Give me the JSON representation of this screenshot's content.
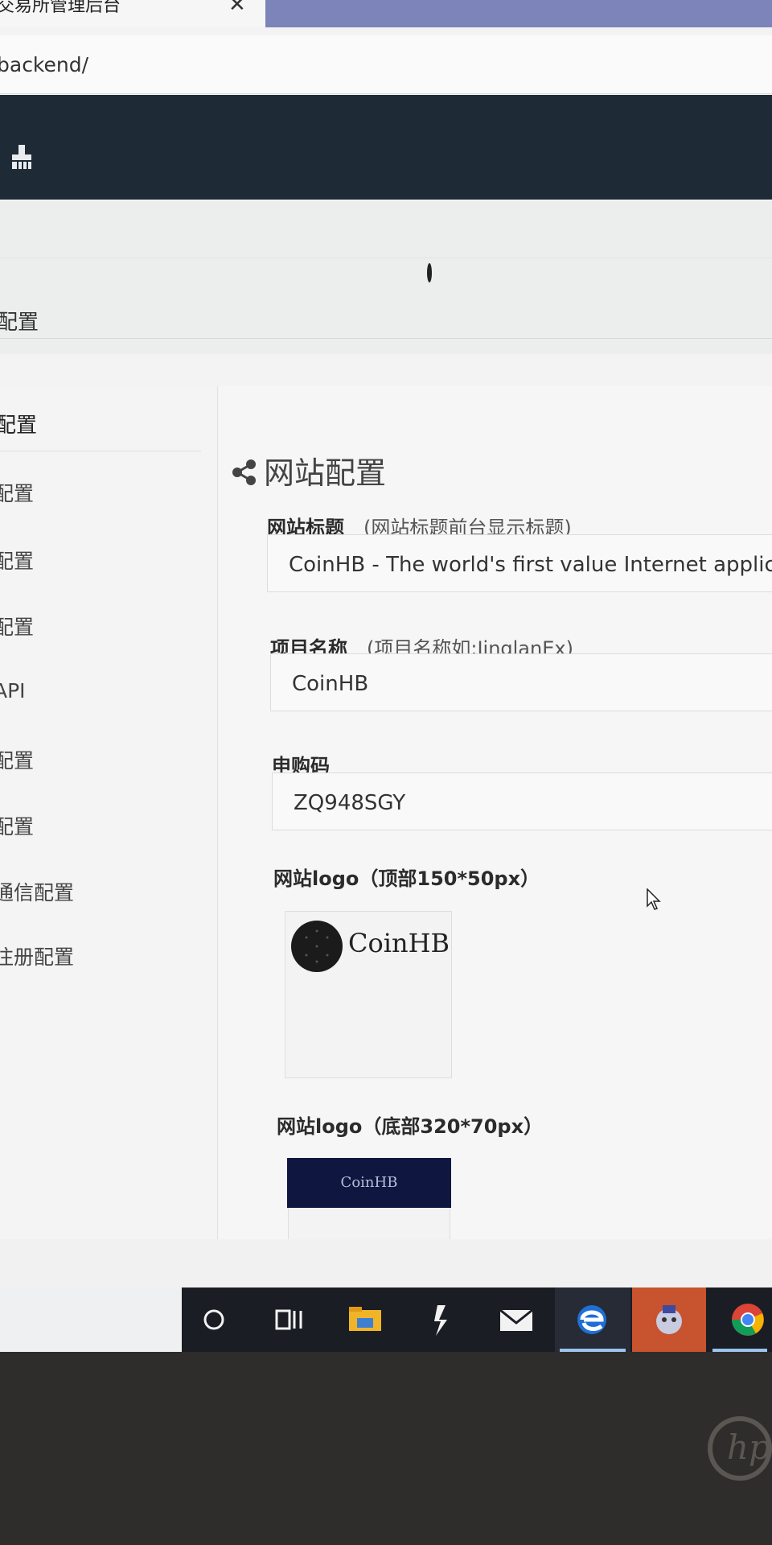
{
  "browser": {
    "tab_title": "交易所管理后台",
    "tab_close": "✕",
    "url": "backend/"
  },
  "breadcrumb": "配置",
  "sidebar": {
    "header": "配置",
    "items": [
      "配置",
      "配置",
      "配置",
      "API",
      "配置",
      "配置",
      "通信配置",
      "注册配置"
    ]
  },
  "main": {
    "section_title": "网站配置",
    "fields": [
      {
        "label": "网站标题",
        "hint": "(网站标题前台显示标题)",
        "value": "CoinHB - The world's first value Internet application"
      },
      {
        "label": "项目名称",
        "hint": "(项目名称如:JinglanEx)",
        "value": "CoinHB"
      },
      {
        "label": "申购码",
        "hint": "",
        "value": "ZQ948SGY"
      }
    ],
    "logo_top": {
      "label": "网站logo（顶部150*50px）",
      "brand": "CoinHB"
    },
    "logo_bottom": {
      "label": "网站logo（底部320*70px）",
      "brand": "CoinHB"
    }
  },
  "taskbar": {
    "icons": [
      "cortana-icon",
      "task-view-icon",
      "file-explorer-icon",
      "app-icon",
      "mail-icon",
      "edge-icon",
      "game-icon",
      "chrome-icon"
    ]
  },
  "colors": {
    "header_bg": "#1f2a37",
    "logo_bottom_bg": "#0f1740",
    "taskbar_bg": "#1a1d24"
  }
}
